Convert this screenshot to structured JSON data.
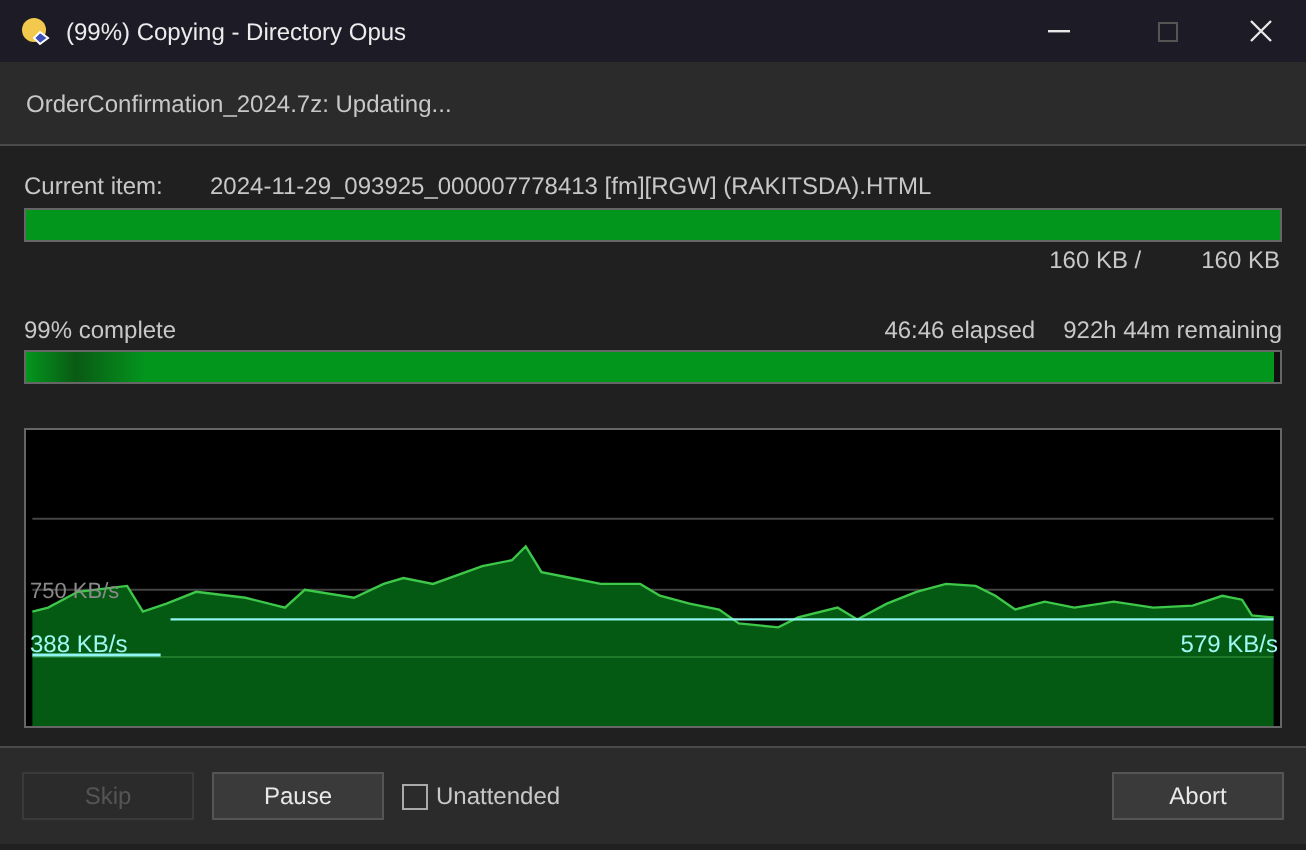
{
  "window": {
    "title": "(99%) Copying - Directory Opus"
  },
  "header": {
    "status": "OrderConfirmation_2024.7z: Updating..."
  },
  "current_item": {
    "label": "Current item:",
    "name": "2024-11-29_093925_000007778413 [fm][RGW] (RAKITSDA).HTML",
    "level": 1.0,
    "done": "160 KB /",
    "total": "160 KB"
  },
  "overall": {
    "label": "99% complete",
    "elapsed": "46:46 elapsed",
    "remaining": "922h 44m remaining",
    "level": 0.995
  },
  "graph": {
    "gridline_label": "750 KB/s",
    "start_speed": "388 KB/s",
    "current_speed": "579 KB/s"
  },
  "buttons": [
    {
      "label": "Skip",
      "disabled": true
    },
    {
      "label": "Pause",
      "disabled": false
    }
  ],
  "unattended": {
    "label": "Unattended",
    "checked": false
  },
  "abort": {
    "label": "Abort"
  }
}
